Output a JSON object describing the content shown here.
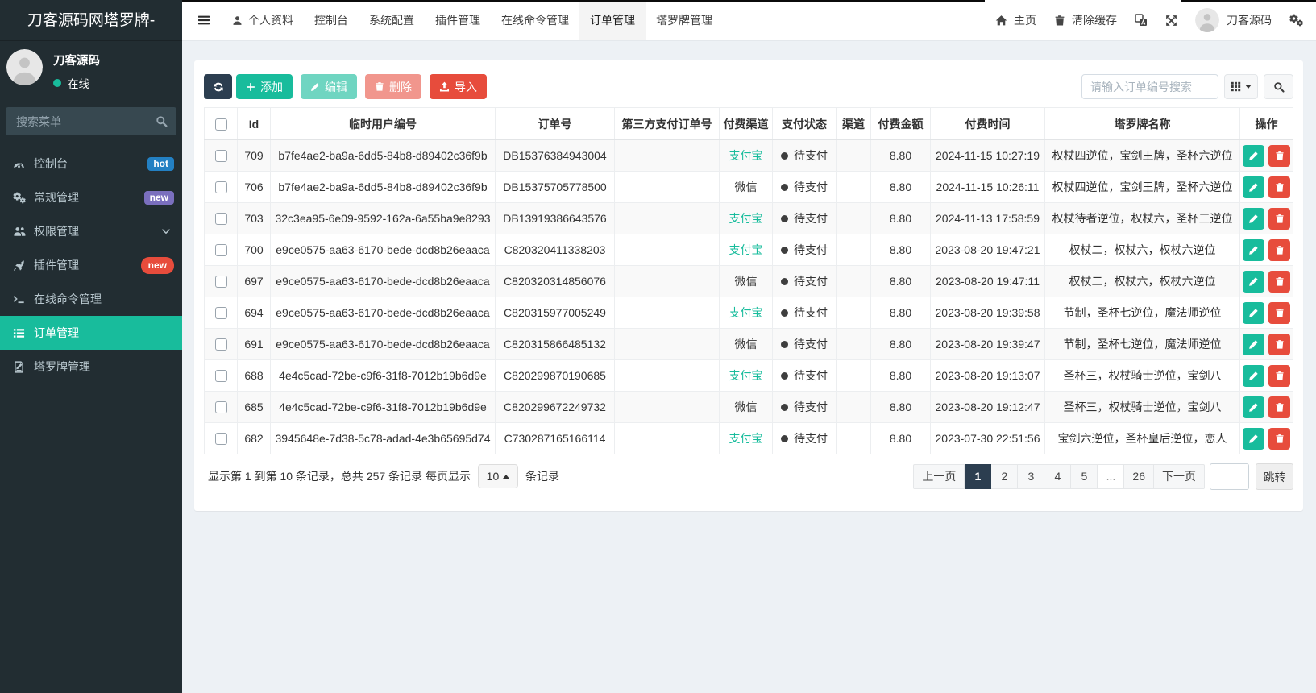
{
  "sidebar": {
    "title": "刀客源码网塔罗牌-",
    "user": {
      "name": "刀客源码",
      "status": "在线",
      "status_color": "#18bc9c"
    },
    "search_placeholder": "搜索菜单",
    "menu": [
      {
        "label": "控制台",
        "icon": "dashboard-icon",
        "badge": "hot",
        "badge_color": "#2380c3"
      },
      {
        "label": "常规管理",
        "icon": "cogs-icon",
        "badge": "new",
        "badge_color": "#7a6fbe"
      },
      {
        "label": "权限管理",
        "icon": "users-icon",
        "chevron": "down"
      },
      {
        "label": "插件管理",
        "icon": "rocket-icon",
        "badge": "new",
        "badge_color": "#e74c3c",
        "badge_pill": true
      },
      {
        "label": "在线命令管理",
        "icon": "terminal-icon"
      },
      {
        "label": "订单管理",
        "icon": "list-icon",
        "active": true
      },
      {
        "label": "塔罗牌管理",
        "icon": "tarot-icon"
      }
    ],
    "colors": {
      "background": "#222d32",
      "active": "#18bc9c"
    }
  },
  "topnav": {
    "tabs": [
      {
        "label": "个人资料",
        "icon": "user-icon"
      },
      {
        "label": "控制台"
      },
      {
        "label": "系统配置"
      },
      {
        "label": "插件管理"
      },
      {
        "label": "在线命令管理"
      },
      {
        "label": "订单管理",
        "active": true
      },
      {
        "label": "塔罗牌管理"
      }
    ],
    "right": {
      "home_label": "主页",
      "clear_cache_label": "清除缓存",
      "user_label": "刀客源码"
    }
  },
  "toolbar": {
    "add_label": "添加",
    "edit_label": "编辑",
    "delete_label": "删除",
    "import_label": "导入",
    "search_placeholder": "请输入订单编号搜索"
  },
  "table": {
    "columns": [
      "",
      "Id",
      "临时用户编号",
      "订单号",
      "第三方支付订单号",
      "付费渠道",
      "支付状态",
      "渠道",
      "付费金额",
      "付费时间",
      "塔罗牌名称",
      "操作"
    ],
    "channel_colors": {
      "支付宝": "#18bc9c",
      "微信": "#333333"
    },
    "status_dot_color": "#3e3e3e",
    "rows": [
      {
        "id": "709",
        "user_no": "b7fe4ae2-ba9a-6dd5-84b8-d89402c36f9b",
        "order_no": "DB15376384943004",
        "third_no": "",
        "channel": "支付宝",
        "status": "待支付",
        "channel2": "",
        "amount": "8.80",
        "time": "2024-11-15 10:27:19",
        "tarot": "权杖四逆位，宝剑王牌，圣杯六逆位"
      },
      {
        "id": "706",
        "user_no": "b7fe4ae2-ba9a-6dd5-84b8-d89402c36f9b",
        "order_no": "DB15375705778500",
        "third_no": "",
        "channel": "微信",
        "status": "待支付",
        "channel2": "",
        "amount": "8.80",
        "time": "2024-11-15 10:26:11",
        "tarot": "权杖四逆位，宝剑王牌，圣杯六逆位"
      },
      {
        "id": "703",
        "user_no": "32c3ea95-6e09-9592-162a-6a55ba9e8293",
        "order_no": "DB13919386643576",
        "third_no": "",
        "channel": "支付宝",
        "status": "待支付",
        "channel2": "",
        "amount": "8.80",
        "time": "2024-11-13 17:58:59",
        "tarot": "权杖待者逆位，权杖六，圣杯三逆位"
      },
      {
        "id": "700",
        "user_no": "e9ce0575-aa63-6170-bede-dcd8b26eaaca",
        "order_no": "C820320411338203",
        "third_no": "",
        "channel": "支付宝",
        "status": "待支付",
        "channel2": "",
        "amount": "8.80",
        "time": "2023-08-20 19:47:21",
        "tarot": "权杖二，权杖六，权杖六逆位"
      },
      {
        "id": "697",
        "user_no": "e9ce0575-aa63-6170-bede-dcd8b26eaaca",
        "order_no": "C820320314856076",
        "third_no": "",
        "channel": "微信",
        "status": "待支付",
        "channel2": "",
        "amount": "8.80",
        "time": "2023-08-20 19:47:11",
        "tarot": "权杖二，权杖六，权杖六逆位"
      },
      {
        "id": "694",
        "user_no": "e9ce0575-aa63-6170-bede-dcd8b26eaaca",
        "order_no": "C820315977005249",
        "third_no": "",
        "channel": "支付宝",
        "status": "待支付",
        "channel2": "",
        "amount": "8.80",
        "time": "2023-08-20 19:39:58",
        "tarot": "节制，圣杯七逆位，魔法师逆位"
      },
      {
        "id": "691",
        "user_no": "e9ce0575-aa63-6170-bede-dcd8b26eaaca",
        "order_no": "C820315866485132",
        "third_no": "",
        "channel": "微信",
        "status": "待支付",
        "channel2": "",
        "amount": "8.80",
        "time": "2023-08-20 19:39:47",
        "tarot": "节制，圣杯七逆位，魔法师逆位"
      },
      {
        "id": "688",
        "user_no": "4e4c5cad-72be-c9f6-31f8-7012b19b6d9e",
        "order_no": "C820299870190685",
        "third_no": "",
        "channel": "支付宝",
        "status": "待支付",
        "channel2": "",
        "amount": "8.80",
        "time": "2023-08-20 19:13:07",
        "tarot": "圣杯三，权杖骑士逆位，宝剑八"
      },
      {
        "id": "685",
        "user_no": "4e4c5cad-72be-c9f6-31f8-7012b19b6d9e",
        "order_no": "C820299672249732",
        "third_no": "",
        "channel": "微信",
        "status": "待支付",
        "channel2": "",
        "amount": "8.80",
        "time": "2023-08-20 19:12:47",
        "tarot": "圣杯三，权杖骑士逆位，宝剑八"
      },
      {
        "id": "682",
        "user_no": "3945648e-7d38-5c78-adad-4e3b65695d74",
        "order_no": "C730287165166114",
        "third_no": "",
        "channel": "支付宝",
        "status": "待支付",
        "channel2": "",
        "amount": "8.80",
        "time": "2023-07-30 22:51:56",
        "tarot": "宝剑六逆位，圣杯皇后逆位，恋人"
      }
    ]
  },
  "footer": {
    "summary_prefix": "显示第 1 到第 10 条记录，总共 257 条记录 每页显示",
    "page_size": "10",
    "summary_suffix": "条记录",
    "jump_label": "跳转"
  },
  "pagination": {
    "items": [
      "上一页",
      "1",
      "2",
      "3",
      "4",
      "5",
      "...",
      "26",
      "下一页"
    ],
    "active": "1",
    "active_color": "#2c3e50"
  },
  "colors": {
    "primary": "#2c3e50",
    "success": "#18bc9c",
    "danger": "#e74c3c",
    "page_background": "#edf1f5"
  }
}
